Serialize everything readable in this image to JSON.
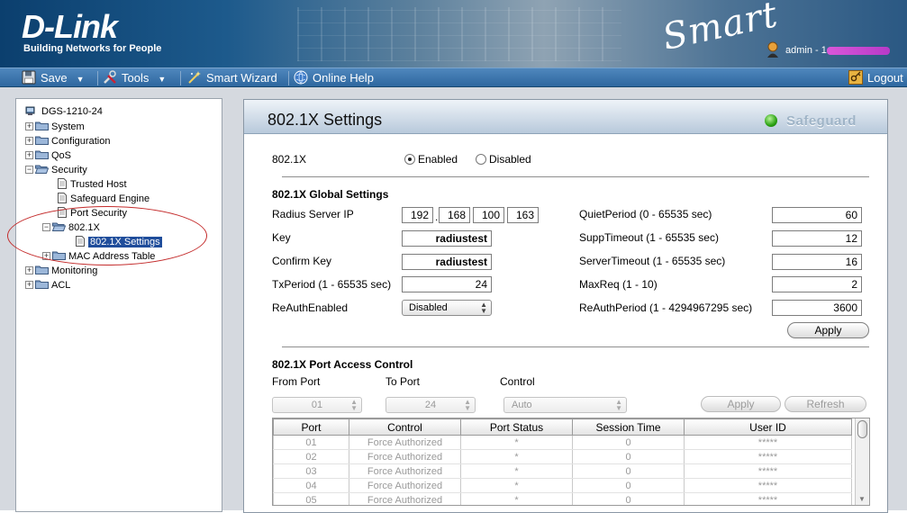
{
  "header": {
    "brand": "D-Link",
    "tagline": "Building Networks for People",
    "product_logo": "Smart",
    "user_label": "admin - 1",
    "user_icon": "user-icon"
  },
  "toolbar": {
    "save_label": "Save",
    "tools_label": "Tools",
    "wizard_label": "Smart Wizard",
    "help_label": "Online Help",
    "logout_label": "Logout"
  },
  "tree": {
    "root": "DGS-1210-24",
    "system": "System",
    "configuration": "Configuration",
    "qos": "QoS",
    "security": "Security",
    "trusted_host": "Trusted Host",
    "safeguard_engine": "Safeguard Engine",
    "port_security": "Port Security",
    "dot1x": "802.1X",
    "dot1x_settings": "802.1X Settings",
    "mac_table": "MAC Address Table",
    "monitoring": "Monitoring",
    "acl": "ACL"
  },
  "panel": {
    "title": "802.1X Settings",
    "safeguard": "Safeguard"
  },
  "state": {
    "label": "802.1X",
    "enabled": "Enabled",
    "disabled": "Disabled",
    "selected": "Enabled"
  },
  "global": {
    "heading": "802.1X Global Settings",
    "radius_label": "Radius Server IP",
    "radius_ip": [
      "192",
      "168",
      "100",
      "163"
    ],
    "key_label": "Key",
    "key_value": "radiustest",
    "confirm_label": "Confirm Key",
    "confirm_value": "radiustest",
    "txperiod_label": "TxPeriod (1 - 65535 sec)",
    "txperiod_value": "24",
    "reauth_enabled_label": "ReAuthEnabled",
    "reauth_enabled_value": "Disabled",
    "quiet_label": "QuietPeriod (0 - 65535 sec)",
    "quiet_value": "60",
    "supp_label": "SuppTimeout (1 - 65535 sec)",
    "supp_value": "12",
    "server_label": "ServerTimeout (1 - 65535 sec)",
    "server_value": "16",
    "maxreq_label": "MaxReq (1 - 10)",
    "maxreq_value": "2",
    "reauth_period_label": "ReAuthPeriod (1 - 4294967295 sec)",
    "reauth_period_value": "3600",
    "apply_label": "Apply"
  },
  "port_access": {
    "heading": "802.1X Port Access Control",
    "from_label": "From Port",
    "to_label": "To Port",
    "control_label": "Control",
    "from_value": "01",
    "to_value": "24",
    "control_value": "Auto",
    "apply_label": "Apply",
    "refresh_label": "Refresh"
  },
  "table": {
    "columns": [
      "Port",
      "Control",
      "Port Status",
      "Session Time",
      "User ID"
    ],
    "rows": [
      [
        "01",
        "Force Authorized",
        "*",
        "0",
        "*****"
      ],
      [
        "02",
        "Force Authorized",
        "*",
        "0",
        "*****"
      ],
      [
        "03",
        "Force Authorized",
        "*",
        "0",
        "*****"
      ],
      [
        "04",
        "Force Authorized",
        "*",
        "0",
        "*****"
      ],
      [
        "05",
        "Force Authorized",
        "*",
        "0",
        "*****"
      ]
    ]
  }
}
